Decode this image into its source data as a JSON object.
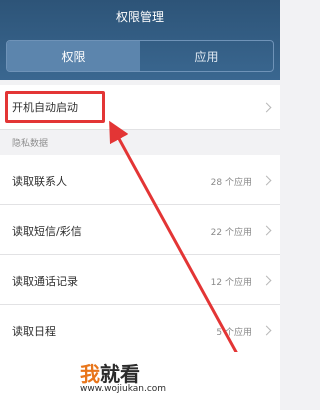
{
  "header": {
    "title": "权限管理",
    "tabs": [
      {
        "label": "权限",
        "active": true
      },
      {
        "label": "应用",
        "active": false
      }
    ]
  },
  "list": {
    "autostart": {
      "label": "开机自动启动"
    },
    "section_privacy": "隐私数据",
    "items": [
      {
        "label": "读取联系人",
        "count": "28 个应用"
      },
      {
        "label": "读取短信/彩信",
        "count": "22 个应用"
      },
      {
        "label": "读取通话记录",
        "count": "12 个应用"
      },
      {
        "label": "读取日程",
        "count": "5 个应用"
      }
    ]
  },
  "annotation": {
    "color": "#e33535"
  },
  "watermark": {
    "brand_part1": "我",
    "brand_part2": "就看",
    "url": "www.wojiukan.com",
    "colors": {
      "orange": "#e8751a",
      "dark": "#2b2b2b"
    }
  },
  "colors": {
    "header": "#2d5478",
    "active_tab": "#5c85ad"
  }
}
